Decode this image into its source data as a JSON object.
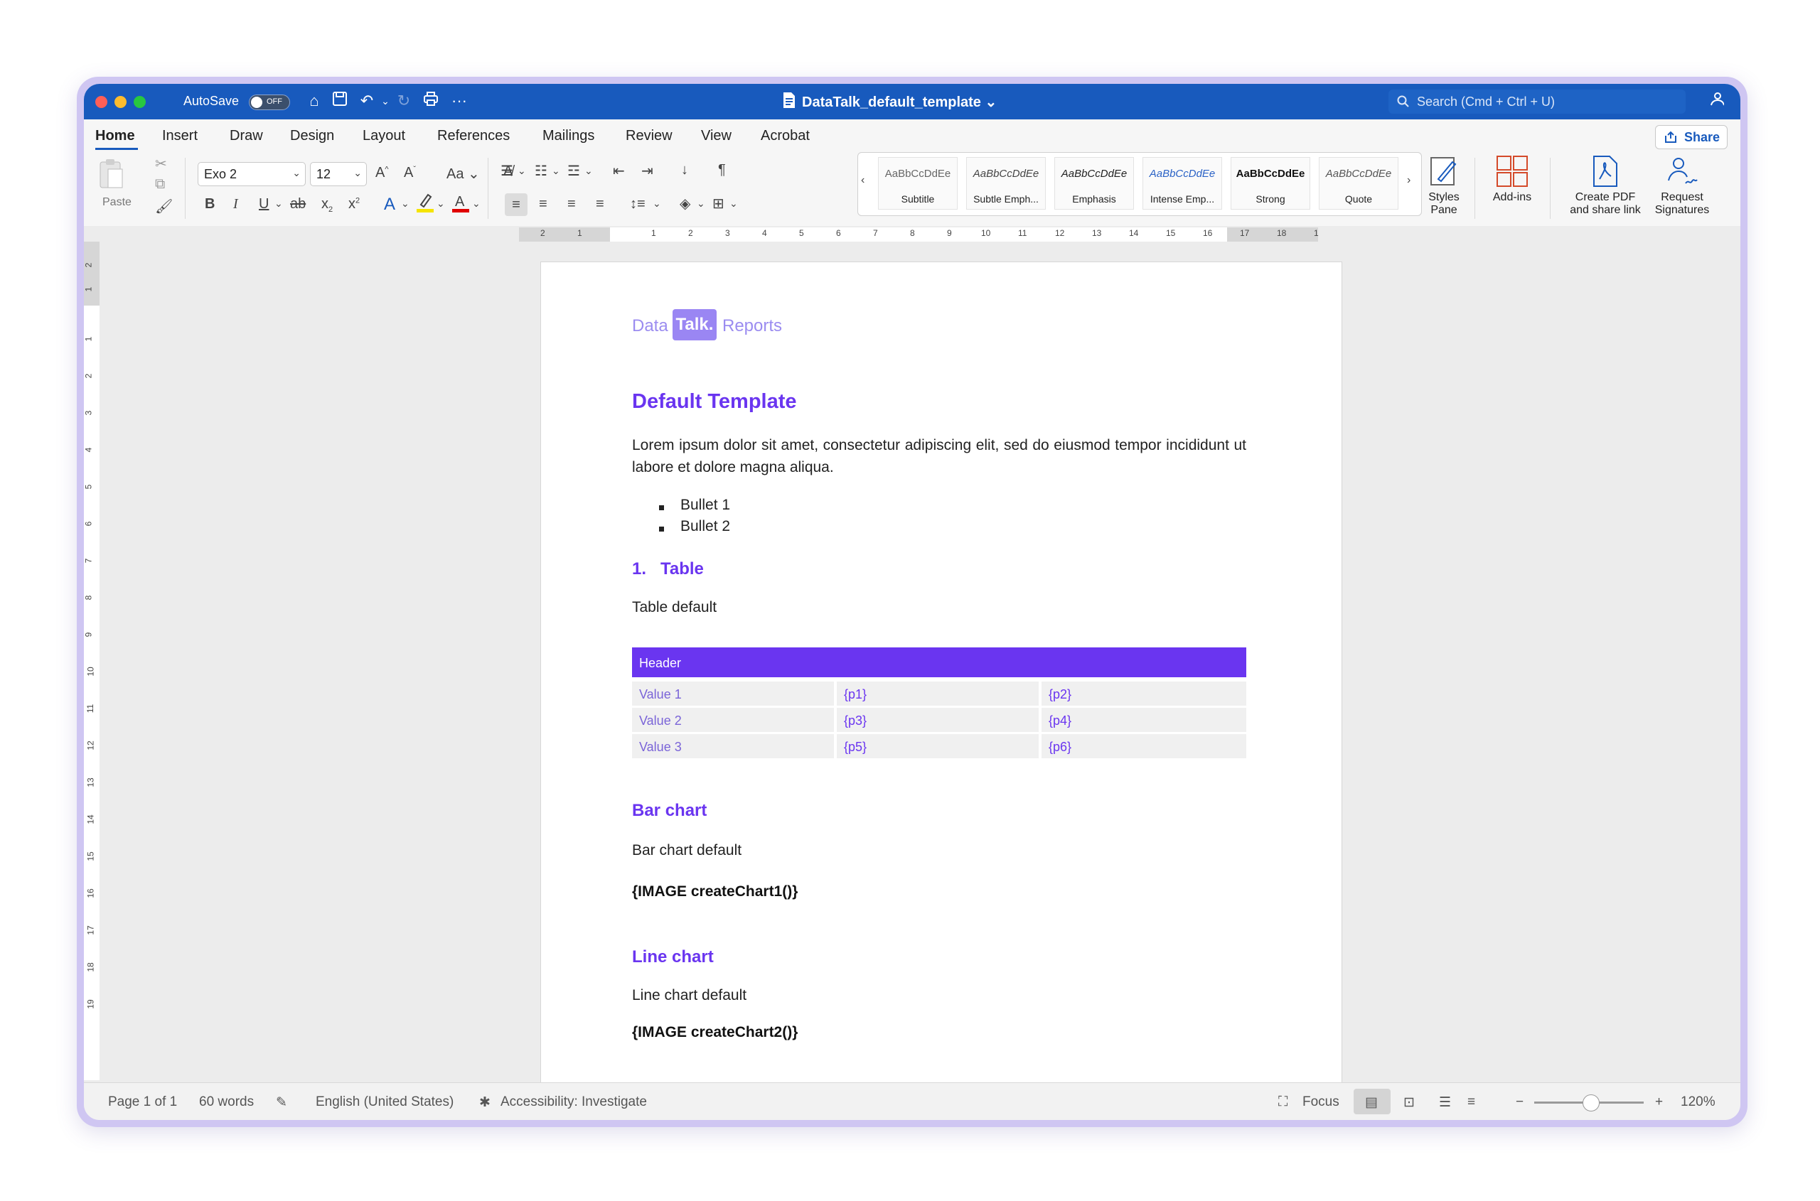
{
  "window": {
    "autosave_label": "AutoSave",
    "autosave_state": "OFF",
    "doc_title": "DataTalk_default_template",
    "search_placeholder": "Search (Cmd + Ctrl + U)"
  },
  "tabs": [
    "Home",
    "Insert",
    "Draw",
    "Design",
    "Layout",
    "References",
    "Mailings",
    "Review",
    "View",
    "Acrobat"
  ],
  "share_label": "Share",
  "toolbar": {
    "paste_label": "Paste",
    "font_name": "Exo 2",
    "font_size": "12",
    "styles": [
      {
        "preview": "AaBbCcDdEe",
        "name": "Subtitle"
      },
      {
        "preview": "AaBbCcDdEe",
        "name": "Subtle Emph..."
      },
      {
        "preview": "AaBbCcDdEe",
        "name": "Emphasis"
      },
      {
        "preview": "AaBbCcDdEe",
        "name": "Intense Emp..."
      },
      {
        "preview": "AaBbCcDdEe",
        "name": "Strong"
      },
      {
        "preview": "AaBbCcDdEe",
        "name": "Quote"
      }
    ],
    "styles_pane_1": "Styles",
    "styles_pane_2": "Pane",
    "addins_label": "Add-ins",
    "create_pdf_1": "Create PDF",
    "create_pdf_2": "and share link",
    "request_sig_1": "Request",
    "request_sig_2": "Signatures"
  },
  "ruler": {
    "h_numbers": [
      "2",
      "1",
      "1",
      "2",
      "3",
      "4",
      "5",
      "6",
      "7",
      "8",
      "9",
      "10",
      "11",
      "12",
      "13",
      "14",
      "15",
      "16",
      "17",
      "18",
      "1"
    ],
    "v_numbers": [
      "2",
      "1",
      "1",
      "2",
      "3",
      "4",
      "5",
      "6",
      "7",
      "8",
      "9",
      "10",
      "11",
      "12",
      "13",
      "14",
      "15",
      "16",
      "17",
      "18",
      "19"
    ]
  },
  "document": {
    "logo": {
      "left": "Data",
      "middle": "Talk.",
      "right": "Reports"
    },
    "title": "Default Template",
    "paragraph": "Lorem ipsum dolor sit amet, consectetur adipiscing elit, sed do eiusmod tempor incididunt ut labore et dolore magna aliqua.",
    "bullets": [
      "Bullet 1",
      "Bullet 2"
    ],
    "section1_num": "1.",
    "section1_title": "Table",
    "table_caption": "Table default",
    "table_header": "Header",
    "table_rows": [
      [
        "Value 1",
        "{p1}",
        "{p2}"
      ],
      [
        "Value 2",
        "{p3}",
        "{p4}"
      ],
      [
        "Value 3",
        "{p5}",
        "{p6}"
      ]
    ],
    "bar_title": "Bar chart",
    "bar_caption": "Bar chart default",
    "bar_code": "{IMAGE createChart1()}",
    "line_title": "Line chart",
    "line_caption": "Line chart default",
    "line_code": "{IMAGE createChart2()}"
  },
  "status": {
    "page": "Page 1 of 1",
    "words": "60 words",
    "language": "English (United States)",
    "accessibility": "Accessibility: Investigate",
    "focus": "Focus",
    "zoom": "120%"
  },
  "colors": {
    "accent": "#6a35f0",
    "titlebar": "#185abd",
    "logo": "#9a86f3"
  }
}
